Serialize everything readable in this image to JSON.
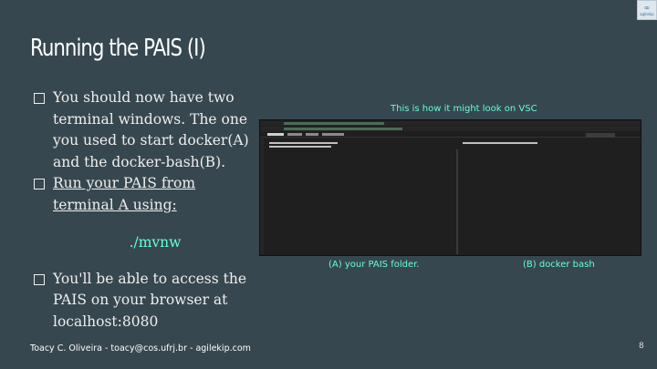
{
  "logo": {
    "symbol": "∞",
    "text": "agilekip"
  },
  "slide": {
    "title": "Running the PAIS (I)",
    "bullets": [
      "You should now have two terminal windows. The one you used to start docker(A) and the docker-bash(B).",
      "Run your PAIS from terminal A using:",
      "You'll be able to access the PAIS on your browser at localhost:8080"
    ],
    "command": "./mvnw"
  },
  "screenshot": {
    "caption": "This is how it might look on VSC",
    "label_a": "(A)  your PAIS folder.",
    "label_b": "(B) docker bash"
  },
  "footer": "Toacy C. Oliveira - toacy@cos.ufrj.br - agilekip.com",
  "page_number": "8"
}
